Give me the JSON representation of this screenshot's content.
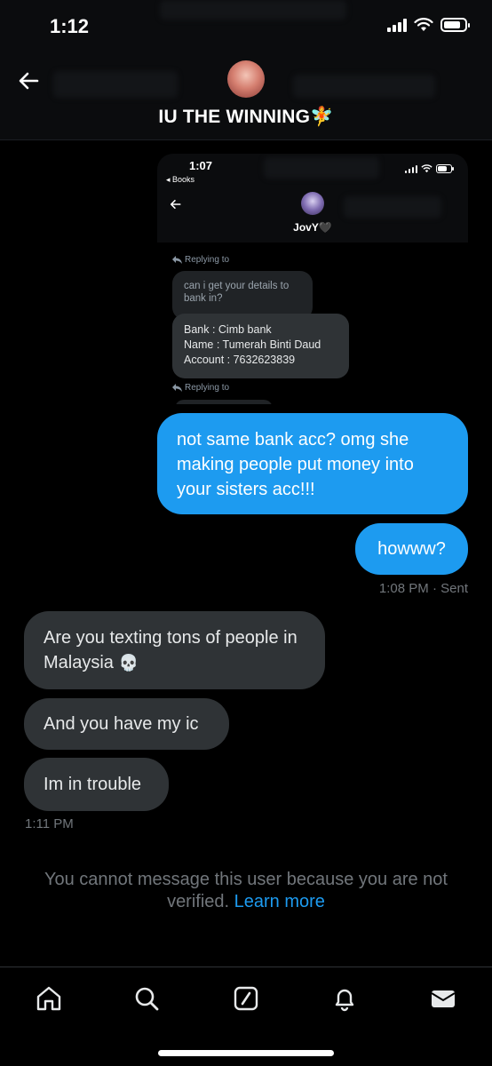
{
  "status_bar": {
    "time": "1:12",
    "battery_level": 0.8
  },
  "header": {
    "title": "IU THE WINNING",
    "title_emoji": "🧚"
  },
  "embedded_screenshot": {
    "time": "1:07",
    "back_app": "◂ Books",
    "name": "JovY",
    "name_emoji": "🖤",
    "reply_label_1": "Replying to",
    "quoted_message": "can i get your details to bank in?",
    "bank_message": {
      "line1": "Bank : Cimb bank",
      "line2": "Name : Tumerah Binti Daud",
      "line3": "Account : 7632623839"
    },
    "reply_label_2": "Replying to"
  },
  "messages": {
    "sent_1": "not same bank acc? omg she making people put money into your sisters acc!!!",
    "sent_2": "howww?",
    "sent_meta_time": "1:08 PM",
    "sent_meta_status": "· Sent",
    "recv_1": "Are you texting tons of people in Malaysia",
    "recv_1_emoji": "💀",
    "recv_2": "And you have my ic",
    "recv_3": "Im in trouble",
    "recv_meta_time": "1:11 PM"
  },
  "notice": {
    "text": "You cannot message this user because you are not verified.",
    "link": "Learn more"
  },
  "nav": [
    "home-icon",
    "search-icon",
    "compose-icon",
    "notifications-icon",
    "messages-icon"
  ],
  "colors": {
    "accent": "#1d9bf0",
    "bubble_received": "#2f3336",
    "muted": "#71767b"
  }
}
